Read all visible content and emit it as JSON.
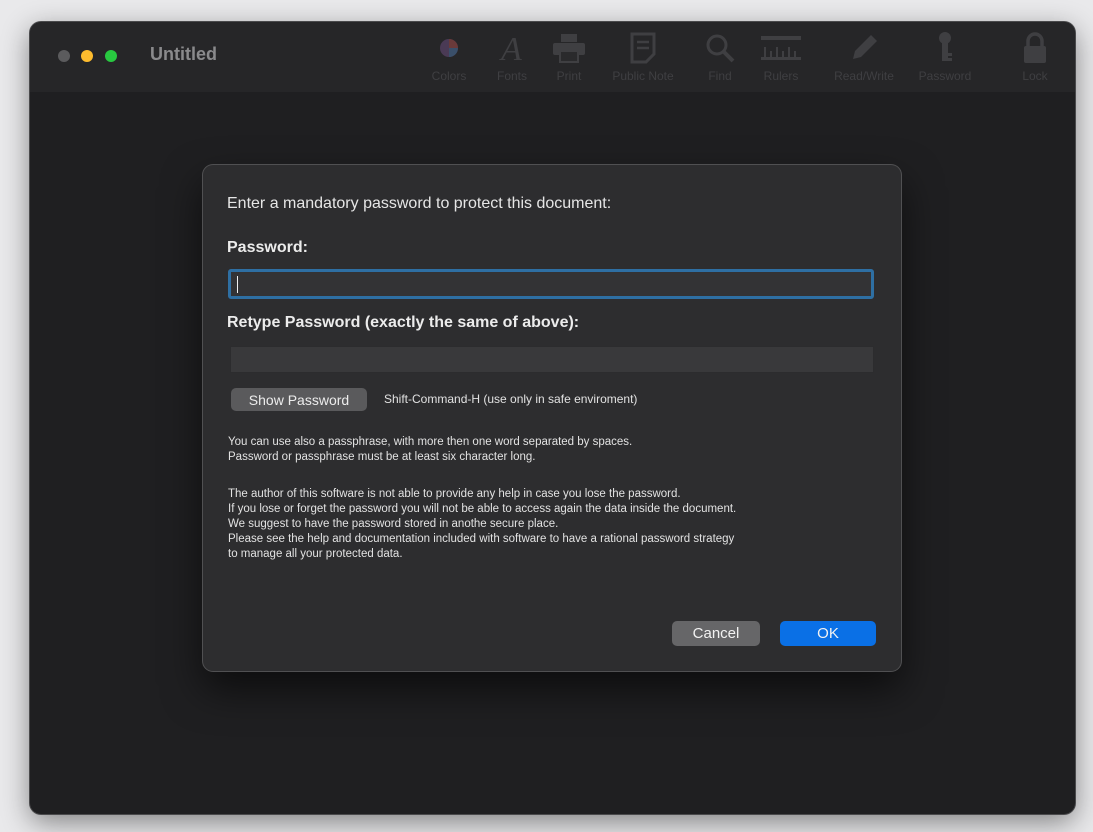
{
  "window": {
    "title": "Untitled"
  },
  "toolbar": {
    "items": [
      {
        "label": "Colors",
        "icon": "color-wheel-icon"
      },
      {
        "label": "Fonts",
        "icon": "font-icon"
      },
      {
        "label": "Print",
        "icon": "printer-icon"
      },
      {
        "label": "Public Note",
        "icon": "note-icon"
      },
      {
        "label": "Find",
        "icon": "magnifier-icon"
      },
      {
        "label": "Rulers",
        "icon": "ruler-icon"
      },
      {
        "label": "Read/Write",
        "icon": "pencil-icon"
      },
      {
        "label": "Password",
        "icon": "key-icon"
      },
      {
        "label": "Lock",
        "icon": "padlock-icon"
      }
    ]
  },
  "dialog": {
    "prompt": "Enter a mandatory password to protect this document:",
    "password_label": "Password:",
    "password_value": "",
    "retype_label": "Retype Password (exactly the same of above):",
    "retype_value": "",
    "show_password_label": "Show Password",
    "shortcut_hint": "Shift-Command-H (use only in safe enviroment)",
    "passphrase_lines": [
      "You can use also a passphrase, with more then one word separated by spaces.",
      "Password or passphrase must be at least six character long."
    ],
    "warning_lines": [
      "The author of this software is not able to provide any help in case you lose the password.",
      "If you lose or forget the password you will not be able to access again the data inside the document.",
      "We suggest to have the password stored in anothe secure place.",
      "Please see the help and documentation included with software to have a rational password strategy",
      "to manage all your protected data."
    ],
    "cancel_label": "Cancel",
    "ok_label": "OK"
  },
  "colors": {
    "accent": "#0a70e6",
    "focus_ring": "#2e6fa3",
    "minimize": "#febc2e",
    "zoom": "#28c840"
  }
}
